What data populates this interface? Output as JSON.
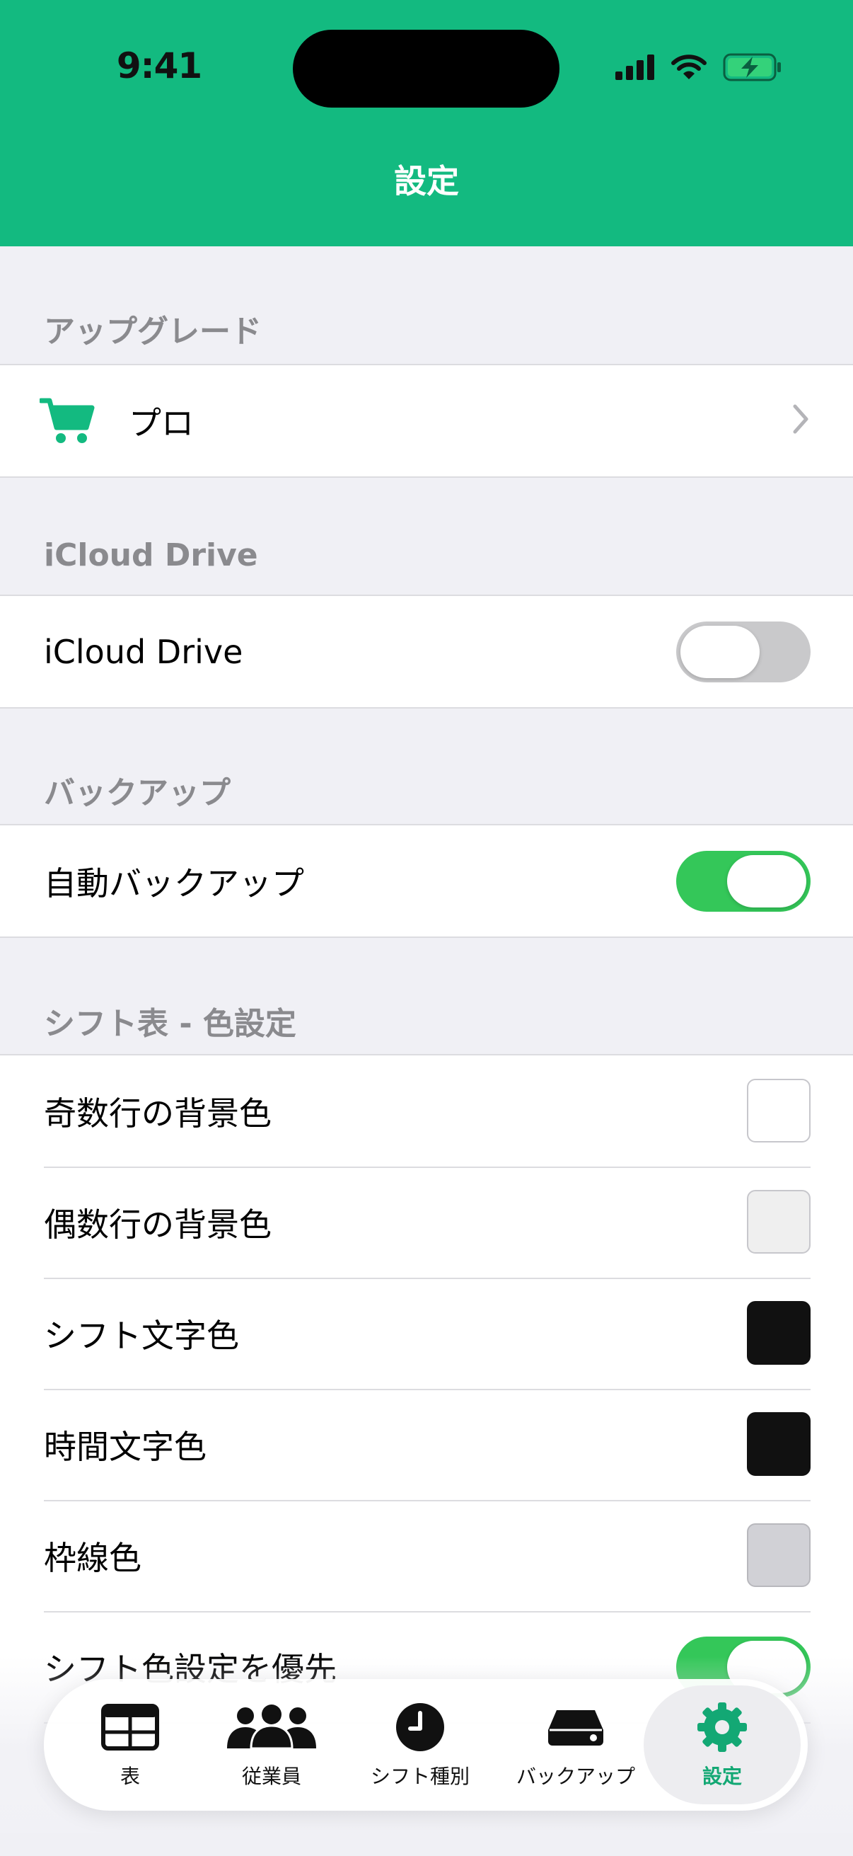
{
  "status_bar": {
    "time": "9:41"
  },
  "nav": {
    "title": "設定"
  },
  "sections": {
    "upgrade": {
      "header": "アップグレード",
      "pro_label": "プロ"
    },
    "icloud": {
      "header": "iCloud Drive",
      "row_label": "iCloud Drive",
      "enabled": false
    },
    "backup": {
      "header": "バックアップ",
      "row_label": "自動バックアップ",
      "enabled": true
    },
    "colors": {
      "header": "シフト表 - 色設定",
      "odd_row_bg": {
        "label": "奇数行の背景色",
        "color": "#FFFFFF"
      },
      "even_row_bg": {
        "label": "偶数行の背景色",
        "color": "#EFEFEF"
      },
      "shift_text": {
        "label": "シフト文字色",
        "color": "#111111"
      },
      "time_text": {
        "label": "時間文字色",
        "color": "#111111"
      },
      "border": {
        "label": "枠線色",
        "color": "#D1D1D6"
      },
      "prioritize_shift_color": {
        "label": "シフト色設定を優先",
        "enabled": true
      }
    }
  },
  "tabs": [
    {
      "label": "表",
      "icon": "table-icon"
    },
    {
      "label": "従業員",
      "icon": "people-icon"
    },
    {
      "label": "シフト種別",
      "icon": "clock-icon"
    },
    {
      "label": "バックアップ",
      "icon": "drive-icon"
    },
    {
      "label": "設定",
      "icon": "gear-icon",
      "active": true
    }
  ],
  "colors": {
    "brand": "#13BA80",
    "toggle_on": "#34C759",
    "toggle_off": "#C9C9CB"
  }
}
